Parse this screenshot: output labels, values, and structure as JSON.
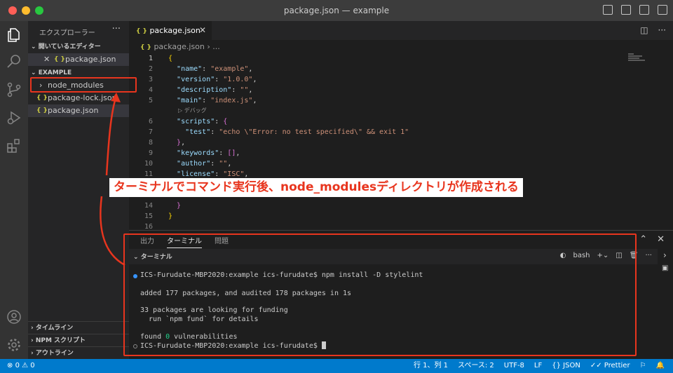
{
  "window": {
    "title": "package.json — example"
  },
  "sidebar": {
    "title": "エクスプローラー",
    "more": "···",
    "open_editors": {
      "label": "開いているエディター",
      "items": [
        {
          "name": "package.json",
          "close": "✕",
          "icon": "{ }"
        }
      ]
    },
    "workspace": {
      "label": "EXAMPLE",
      "items": [
        {
          "name": "node_modules",
          "chevron": "›"
        },
        {
          "name": "package-lock.json",
          "icon": "{ }"
        },
        {
          "name": "package.json",
          "icon": "{ }"
        }
      ]
    },
    "bottom_sections": [
      "タイムライン",
      "NPM スクリプト",
      "アウトライン"
    ]
  },
  "editor": {
    "tab": {
      "label": "package.json",
      "icon": "{ }",
      "close": "✕"
    },
    "breadcrumb": {
      "file": "package.json",
      "sep": "›",
      "rest": "..."
    },
    "codelens": "デバッグ",
    "lines": [
      {
        "n": "1",
        "t": "{"
      },
      {
        "n": "2",
        "t": "  \"name\": \"example\","
      },
      {
        "n": "3",
        "t": "  \"version\": \"1.0.0\","
      },
      {
        "n": "4",
        "t": "  \"description\": \"\","
      },
      {
        "n": "5",
        "t": "  \"main\": \"index.js\","
      },
      {
        "n": "6",
        "t": "  \"scripts\": {"
      },
      {
        "n": "7",
        "t": "    \"test\": \"echo \\\"Error: no test specified\\\" && exit 1\""
      },
      {
        "n": "8",
        "t": "  },"
      },
      {
        "n": "9",
        "t": "  \"keywords\": [],"
      },
      {
        "n": "10",
        "t": "  \"author\": \"\","
      },
      {
        "n": "11",
        "t": "  \"license\": \"ISC\","
      },
      {
        "n": "14",
        "t": "  }"
      },
      {
        "n": "15",
        "t": "}"
      },
      {
        "n": "16",
        "t": ""
      }
    ]
  },
  "panel": {
    "tabs": [
      "出力",
      "ターミナル",
      "問題"
    ],
    "active_tab": "ターミナル",
    "terminal": {
      "section_label": "ターミナル",
      "shell": "bash",
      "lines": [
        "ICS-Furudate-MBP2020:example ics-furudate$ npm install -D stylelint",
        "",
        "added 177 packages, and audited 178 packages in 1s",
        "",
        "33 packages are looking for funding",
        "  run `npm fund` for details",
        "",
        "found 0 vulnerabilities",
        "ICS-Furudate-MBP2020:example ics-furudate$ "
      ],
      "found_prefix": "found ",
      "found_count": "0",
      "found_suffix": " vulnerabilities"
    }
  },
  "statusbar": {
    "errors": "0",
    "warnings": "0",
    "position": "行 1、列 1",
    "spaces": "スペース: 2",
    "encoding": "UTF-8",
    "eol": "LF",
    "language": "JSON",
    "formatter": "Prettier"
  },
  "annotation": {
    "text": "ターミナルでコマンド実行後、node_modulesディレクトリが作成される",
    "color": "#e8351e"
  }
}
